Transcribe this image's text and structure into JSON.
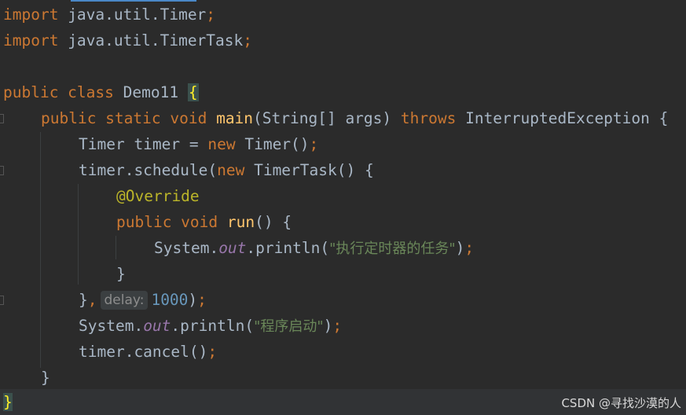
{
  "editor": {
    "language": "java",
    "lines": {
      "l1": {
        "kw": "import",
        "rest": " java.util.Timer",
        "semi": ";"
      },
      "l2": {
        "kw": "import",
        "rest": " java.util.TimerTask",
        "semi": ";"
      },
      "l4": {
        "kw": "public class",
        "name": " Demo11 ",
        "brace": "{"
      },
      "l5": {
        "kw1": "public static void",
        "fn": "main",
        "params": "(String[] args) ",
        "kw2": "throws",
        "exc": " InterruptedException {"
      },
      "l6": {
        "a": "Timer timer = ",
        "kw": "new",
        "b": " Timer()",
        "semi": ";"
      },
      "l7": {
        "a": "timer.schedule(",
        "kw": "new",
        "b": " TimerTask() {"
      },
      "l8": {
        "ann": "@Override"
      },
      "l9": {
        "kw": "public void",
        "fn": "run",
        "b": "() {"
      },
      "l10": {
        "a": "System.",
        "field": "out",
        "b": ".println(",
        "str": "\"执行定时器的任务\"",
        "c": ")",
        "semi": ";"
      },
      "l11": {
        "a": "}"
      },
      "l12": {
        "a": "}",
        "comma": ",",
        "hint": "delay:",
        "num": "1000",
        "c": ")",
        "semi": ";"
      },
      "l13": {
        "a": "System.",
        "field": "out",
        "b": ".println(",
        "str": "\"程序启动\"",
        "c": ")",
        "semi": ";"
      },
      "l14": {
        "a": "timer.cancel()",
        "semi": ";"
      },
      "l15": {
        "a": "}"
      },
      "l16": {
        "a": "}"
      }
    },
    "colors": {
      "background": "#2b2b2b",
      "keyword": "#cc7832",
      "function": "#ffc66d",
      "annotation": "#bbb529",
      "number": "#6897bb",
      "string": "#6a8759",
      "static_field": "#9876aa",
      "text": "#a9b7c6"
    }
  },
  "watermark": "CSDN @寻找沙漠的人"
}
